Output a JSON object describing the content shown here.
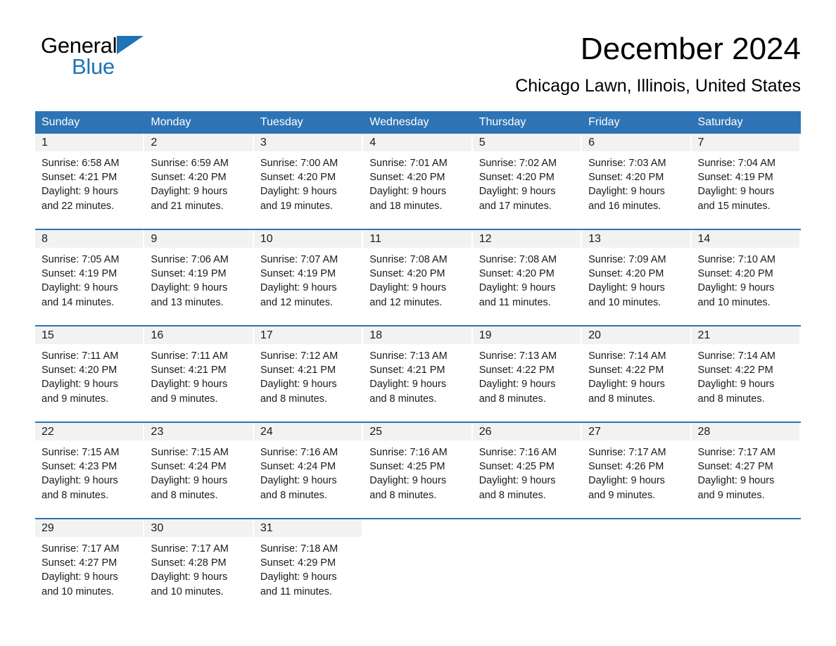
{
  "brand": {
    "name_part1": "General",
    "name_part2": "Blue",
    "accent_color": "#1F74B8"
  },
  "header": {
    "title": "December 2024",
    "subtitle": "Chicago Lawn, Illinois, United States"
  },
  "colors": {
    "header_blue": "#2E74B5",
    "date_band_gray": "#F2F2F2",
    "text": "#1a1a1a"
  },
  "weekday_headers": [
    "Sunday",
    "Monday",
    "Tuesday",
    "Wednesday",
    "Thursday",
    "Friday",
    "Saturday"
  ],
  "weeks": [
    [
      {
        "day": "1",
        "sunrise": "Sunrise: 6:58 AM",
        "sunset": "Sunset: 4:21 PM",
        "daylight_line1": "Daylight: 9 hours",
        "daylight_line2": "and 22 minutes."
      },
      {
        "day": "2",
        "sunrise": "Sunrise: 6:59 AM",
        "sunset": "Sunset: 4:20 PM",
        "daylight_line1": "Daylight: 9 hours",
        "daylight_line2": "and 21 minutes."
      },
      {
        "day": "3",
        "sunrise": "Sunrise: 7:00 AM",
        "sunset": "Sunset: 4:20 PM",
        "daylight_line1": "Daylight: 9 hours",
        "daylight_line2": "and 19 minutes."
      },
      {
        "day": "4",
        "sunrise": "Sunrise: 7:01 AM",
        "sunset": "Sunset: 4:20 PM",
        "daylight_line1": "Daylight: 9 hours",
        "daylight_line2": "and 18 minutes."
      },
      {
        "day": "5",
        "sunrise": "Sunrise: 7:02 AM",
        "sunset": "Sunset: 4:20 PM",
        "daylight_line1": "Daylight: 9 hours",
        "daylight_line2": "and 17 minutes."
      },
      {
        "day": "6",
        "sunrise": "Sunrise: 7:03 AM",
        "sunset": "Sunset: 4:20 PM",
        "daylight_line1": "Daylight: 9 hours",
        "daylight_line2": "and 16 minutes."
      },
      {
        "day": "7",
        "sunrise": "Sunrise: 7:04 AM",
        "sunset": "Sunset: 4:19 PM",
        "daylight_line1": "Daylight: 9 hours",
        "daylight_line2": "and 15 minutes."
      }
    ],
    [
      {
        "day": "8",
        "sunrise": "Sunrise: 7:05 AM",
        "sunset": "Sunset: 4:19 PM",
        "daylight_line1": "Daylight: 9 hours",
        "daylight_line2": "and 14 minutes."
      },
      {
        "day": "9",
        "sunrise": "Sunrise: 7:06 AM",
        "sunset": "Sunset: 4:19 PM",
        "daylight_line1": "Daylight: 9 hours",
        "daylight_line2": "and 13 minutes."
      },
      {
        "day": "10",
        "sunrise": "Sunrise: 7:07 AM",
        "sunset": "Sunset: 4:19 PM",
        "daylight_line1": "Daylight: 9 hours",
        "daylight_line2": "and 12 minutes."
      },
      {
        "day": "11",
        "sunrise": "Sunrise: 7:08 AM",
        "sunset": "Sunset: 4:20 PM",
        "daylight_line1": "Daylight: 9 hours",
        "daylight_line2": "and 12 minutes."
      },
      {
        "day": "12",
        "sunrise": "Sunrise: 7:08 AM",
        "sunset": "Sunset: 4:20 PM",
        "daylight_line1": "Daylight: 9 hours",
        "daylight_line2": "and 11 minutes."
      },
      {
        "day": "13",
        "sunrise": "Sunrise: 7:09 AM",
        "sunset": "Sunset: 4:20 PM",
        "daylight_line1": "Daylight: 9 hours",
        "daylight_line2": "and 10 minutes."
      },
      {
        "day": "14",
        "sunrise": "Sunrise: 7:10 AM",
        "sunset": "Sunset: 4:20 PM",
        "daylight_line1": "Daylight: 9 hours",
        "daylight_line2": "and 10 minutes."
      }
    ],
    [
      {
        "day": "15",
        "sunrise": "Sunrise: 7:11 AM",
        "sunset": "Sunset: 4:20 PM",
        "daylight_line1": "Daylight: 9 hours",
        "daylight_line2": "and 9 minutes."
      },
      {
        "day": "16",
        "sunrise": "Sunrise: 7:11 AM",
        "sunset": "Sunset: 4:21 PM",
        "daylight_line1": "Daylight: 9 hours",
        "daylight_line2": "and 9 minutes."
      },
      {
        "day": "17",
        "sunrise": "Sunrise: 7:12 AM",
        "sunset": "Sunset: 4:21 PM",
        "daylight_line1": "Daylight: 9 hours",
        "daylight_line2": "and 8 minutes."
      },
      {
        "day": "18",
        "sunrise": "Sunrise: 7:13 AM",
        "sunset": "Sunset: 4:21 PM",
        "daylight_line1": "Daylight: 9 hours",
        "daylight_line2": "and 8 minutes."
      },
      {
        "day": "19",
        "sunrise": "Sunrise: 7:13 AM",
        "sunset": "Sunset: 4:22 PM",
        "daylight_line1": "Daylight: 9 hours",
        "daylight_line2": "and 8 minutes."
      },
      {
        "day": "20",
        "sunrise": "Sunrise: 7:14 AM",
        "sunset": "Sunset: 4:22 PM",
        "daylight_line1": "Daylight: 9 hours",
        "daylight_line2": "and 8 minutes."
      },
      {
        "day": "21",
        "sunrise": "Sunrise: 7:14 AM",
        "sunset": "Sunset: 4:22 PM",
        "daylight_line1": "Daylight: 9 hours",
        "daylight_line2": "and 8 minutes."
      }
    ],
    [
      {
        "day": "22",
        "sunrise": "Sunrise: 7:15 AM",
        "sunset": "Sunset: 4:23 PM",
        "daylight_line1": "Daylight: 9 hours",
        "daylight_line2": "and 8 minutes."
      },
      {
        "day": "23",
        "sunrise": "Sunrise: 7:15 AM",
        "sunset": "Sunset: 4:24 PM",
        "daylight_line1": "Daylight: 9 hours",
        "daylight_line2": "and 8 minutes."
      },
      {
        "day": "24",
        "sunrise": "Sunrise: 7:16 AM",
        "sunset": "Sunset: 4:24 PM",
        "daylight_line1": "Daylight: 9 hours",
        "daylight_line2": "and 8 minutes."
      },
      {
        "day": "25",
        "sunrise": "Sunrise: 7:16 AM",
        "sunset": "Sunset: 4:25 PM",
        "daylight_line1": "Daylight: 9 hours",
        "daylight_line2": "and 8 minutes."
      },
      {
        "day": "26",
        "sunrise": "Sunrise: 7:16 AM",
        "sunset": "Sunset: 4:25 PM",
        "daylight_line1": "Daylight: 9 hours",
        "daylight_line2": "and 8 minutes."
      },
      {
        "day": "27",
        "sunrise": "Sunrise: 7:17 AM",
        "sunset": "Sunset: 4:26 PM",
        "daylight_line1": "Daylight: 9 hours",
        "daylight_line2": "and 9 minutes."
      },
      {
        "day": "28",
        "sunrise": "Sunrise: 7:17 AM",
        "sunset": "Sunset: 4:27 PM",
        "daylight_line1": "Daylight: 9 hours",
        "daylight_line2": "and 9 minutes."
      }
    ],
    [
      {
        "day": "29",
        "sunrise": "Sunrise: 7:17 AM",
        "sunset": "Sunset: 4:27 PM",
        "daylight_line1": "Daylight: 9 hours",
        "daylight_line2": "and 10 minutes."
      },
      {
        "day": "30",
        "sunrise": "Sunrise: 7:17 AM",
        "sunset": "Sunset: 4:28 PM",
        "daylight_line1": "Daylight: 9 hours",
        "daylight_line2": "and 10 minutes."
      },
      {
        "day": "31",
        "sunrise": "Sunrise: 7:18 AM",
        "sunset": "Sunset: 4:29 PM",
        "daylight_line1": "Daylight: 9 hours",
        "daylight_line2": "and 11 minutes."
      },
      {
        "day": "",
        "sunrise": "",
        "sunset": "",
        "daylight_line1": "",
        "daylight_line2": ""
      },
      {
        "day": "",
        "sunrise": "",
        "sunset": "",
        "daylight_line1": "",
        "daylight_line2": ""
      },
      {
        "day": "",
        "sunrise": "",
        "sunset": "",
        "daylight_line1": "",
        "daylight_line2": ""
      },
      {
        "day": "",
        "sunrise": "",
        "sunset": "",
        "daylight_line1": "",
        "daylight_line2": ""
      }
    ]
  ]
}
